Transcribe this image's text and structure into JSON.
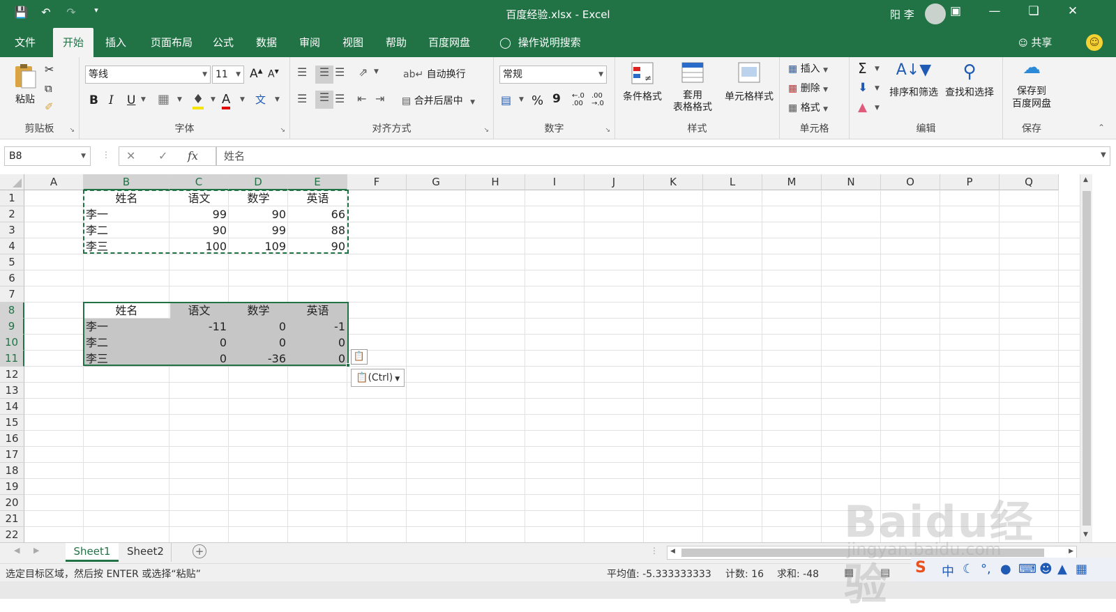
{
  "titlebar": {
    "title": "百度经验.xlsx  -  Excel",
    "user": "阳 李",
    "qat_icons": [
      "save-icon",
      "undo-icon",
      "redo-icon",
      "customize-icon"
    ]
  },
  "tabs": [
    "文件",
    "开始",
    "插入",
    "页面布局",
    "公式",
    "数据",
    "审阅",
    "视图",
    "帮助",
    "百度网盘"
  ],
  "active_tab": "开始",
  "tell_me": "操作说明搜索",
  "share": "共享",
  "ribbon": {
    "clipboard": {
      "paste": "粘贴",
      "label": "剪贴板"
    },
    "font": {
      "name": "等线",
      "size": "11",
      "bold": "B",
      "italic": "I",
      "underline": "U",
      "pinyin": "wén\n文",
      "label": "字体"
    },
    "alignment": {
      "wrap": "自动换行",
      "merge": "合并后居中",
      "label": "对齐方式"
    },
    "number": {
      "format": "常规",
      "percent": "%",
      "comma": "9",
      "label": "数字"
    },
    "styles": {
      "conditional": "条件格式",
      "table_fmt": "套用\n表格格式",
      "cell_styles": "单元格样式",
      "label": "样式"
    },
    "cells": {
      "insert": "插入",
      "delete": "删除",
      "format": "格式",
      "label": "单元格"
    },
    "editing": {
      "sort": "排序和筛选",
      "find": "查找和选择",
      "label": "编辑"
    },
    "save": {
      "save_to": "保存到\n百度网盘",
      "label": "保存"
    }
  },
  "formula_bar": {
    "name_box": "B8",
    "content": "姓名",
    "fx": "fx"
  },
  "columns": [
    "A",
    "B",
    "C",
    "D",
    "E",
    "F",
    "G",
    "H",
    "I",
    "J",
    "K",
    "L",
    "M",
    "N",
    "O",
    "P",
    "Q"
  ],
  "rows": [
    "1",
    "2",
    "3",
    "4",
    "5",
    "6",
    "7",
    "8",
    "9",
    "10",
    "11",
    "12",
    "13",
    "14",
    "15",
    "16",
    "17",
    "18",
    "19",
    "20",
    "21",
    "22"
  ],
  "table1": {
    "headers": [
      "姓名",
      "语文",
      "数学",
      "英语"
    ],
    "rows": [
      [
        "李一",
        "99",
        "90",
        "66"
      ],
      [
        "李二",
        "90",
        "99",
        "88"
      ],
      [
        "李三",
        "100",
        "109",
        "90"
      ]
    ]
  },
  "table2": {
    "headers": [
      "姓名",
      "语文",
      "数学",
      "英语"
    ],
    "rows": [
      [
        "李一",
        "-11",
        "0",
        "-1"
      ],
      [
        "李二",
        "0",
        "0",
        "0"
      ],
      [
        "李三",
        "0",
        "-36",
        "0"
      ]
    ]
  },
  "paste_options": "(Ctrl)",
  "sheets": [
    "Sheet1",
    "Sheet2"
  ],
  "active_sheet": "Sheet1",
  "status": {
    "message": "选定目标区域，然后按 ENTER 或选择“粘贴”",
    "average": "平均值: -5.333333333",
    "count": "计数: 16",
    "sum": "求和: -48"
  },
  "watermark": {
    "logo": "Baidu经验",
    "url": "jingyan.baidu.com"
  },
  "colors": {
    "excel_green": "#217346",
    "selection_shade": "#c6c6c6"
  }
}
